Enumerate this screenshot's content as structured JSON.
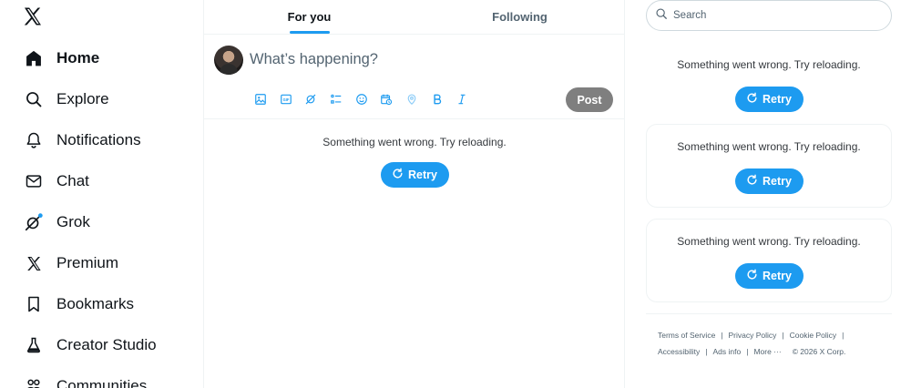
{
  "sidebar": {
    "items": [
      {
        "label": "Home",
        "icon": "home-icon",
        "active": true
      },
      {
        "label": "Explore",
        "icon": "search-icon"
      },
      {
        "label": "Notifications",
        "icon": "bell-icon"
      },
      {
        "label": "Chat",
        "icon": "envelope-icon"
      },
      {
        "label": "Grok",
        "icon": "grok-icon"
      },
      {
        "label": "Premium",
        "icon": "x-logo-icon"
      },
      {
        "label": "Bookmarks",
        "icon": "bookmark-icon"
      },
      {
        "label": "Creator Studio",
        "icon": "flask-icon"
      },
      {
        "label": "Communities",
        "icon": "people-icon"
      }
    ]
  },
  "tabs": [
    {
      "label": "For you",
      "active": true
    },
    {
      "label": "Following",
      "active": false
    }
  ],
  "composer": {
    "placeholder": "What’s happening?",
    "post_label": "Post",
    "tools": [
      "image-icon",
      "gif-icon",
      "grok-icon",
      "poll-icon",
      "emoji-icon",
      "schedule-icon",
      "location-icon",
      "bold-icon",
      "italic-icon"
    ]
  },
  "feed": {
    "error_text": "Something went wrong. Try reloading.",
    "retry_label": "Retry"
  },
  "right": {
    "search_placeholder": "Search",
    "cards": [
      {
        "error_text": "Something went wrong. Try reloading.",
        "retry_label": "Retry"
      },
      {
        "error_text": "Something went wrong. Try reloading.",
        "retry_label": "Retry"
      },
      {
        "error_text": "Something went wrong. Try reloading.",
        "retry_label": "Retry"
      }
    ]
  },
  "footer": {
    "links": [
      "Terms of Service",
      "Privacy Policy",
      "Cookie Policy",
      "Accessibility",
      "Ads info",
      "More ···"
    ],
    "copyright": "© 2026 X Corp."
  },
  "colors": {
    "accent": "#1d9bf0",
    "post_disabled": "#7f7f7f",
    "text_primary": "#0f1419",
    "text_secondary": "#536471",
    "border": "#eff3f4"
  }
}
